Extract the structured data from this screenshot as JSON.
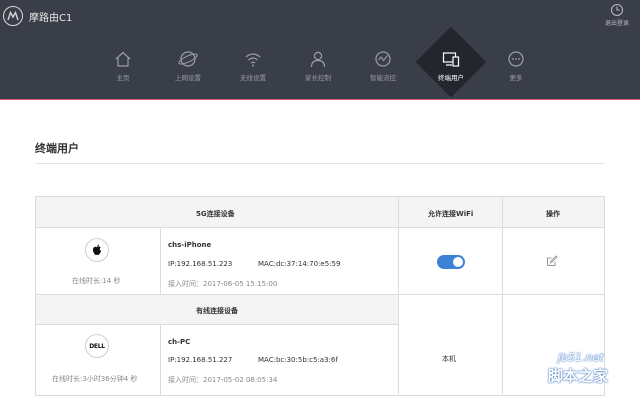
{
  "header": {
    "brand_name": "摩路由C1",
    "logout_label": "退出登录",
    "nav": [
      {
        "label": "主页",
        "icon": "home-icon"
      },
      {
        "label": "上网设置",
        "icon": "globe-icon"
      },
      {
        "label": "无线设置",
        "icon": "wifi-icon"
      },
      {
        "label": "家长控制",
        "icon": "user-icon"
      },
      {
        "label": "智能流控",
        "icon": "gauge-icon"
      },
      {
        "label": "终端用户",
        "icon": "devices-icon",
        "active": true
      },
      {
        "label": "更多",
        "icon": "more-icon"
      }
    ]
  },
  "page": {
    "title": "终端用户"
  },
  "table": {
    "col_allow_wifi": "允许连接WiFi",
    "col_action": "操作",
    "group_5g": "5G连接设备",
    "group_wired": "有线连接设备",
    "devices": [
      {
        "name": "chs-iPhone",
        "ip": "IP:192.168.51.223",
        "mac": "MAC:dc:37:14:70:e5:59",
        "access_time": "接入时间：2017-06-05 15:15:00",
        "online": "在线时长:14 秒",
        "icon": "apple-icon",
        "wifi_allowed": true
      },
      {
        "name": "ch-PC",
        "ip": "IP:192.168.51.227",
        "mac": "MAC:bc:30:5b:c5:a3:6f",
        "access_time": "接入时间：2017-05-02 08:05:34",
        "online": "在线时长:3小时36分钟4 秒",
        "icon": "dell-icon",
        "dell_text": "DELL",
        "status": "本机"
      }
    ]
  },
  "watermark": {
    "site": "jb51.net",
    "name": "脚本之家"
  }
}
